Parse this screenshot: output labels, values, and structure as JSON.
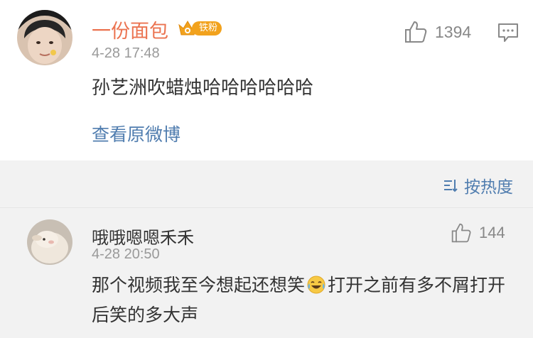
{
  "main_comment": {
    "username": "一份面包",
    "badge_label": "铁粉",
    "badge_color": "#f2a21d",
    "time": "4-28 17:48",
    "like_count": "1394",
    "text": "孙艺洲吹蜡烛哈哈哈哈哈哈",
    "view_original_label": "查看原微博"
  },
  "sort": {
    "label": "按热度"
  },
  "reply": {
    "username": "哦哦嗯嗯禾禾",
    "time": "4-28 20:50",
    "like_count": "144",
    "text_before_emoji": "那个视频我至今想起还想笑",
    "emoji": "laughing-tears-emoji",
    "text_after_emoji": "打开之前有多不屑打开后笑的多大声"
  },
  "colors": {
    "accent_orange": "#eb7350",
    "link_blue": "#507daf",
    "muted_gray": "#999999"
  }
}
